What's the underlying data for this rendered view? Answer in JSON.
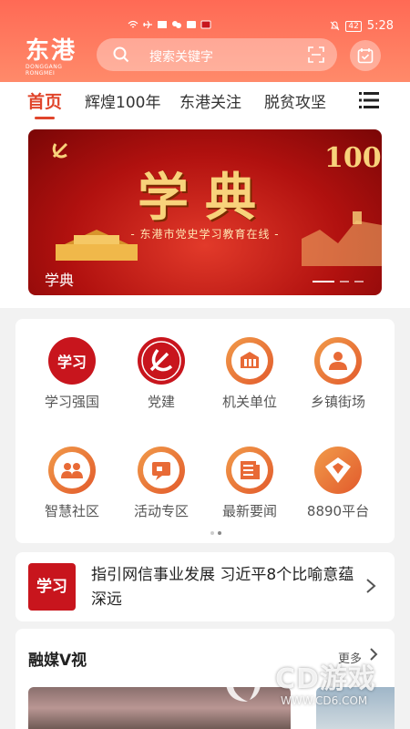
{
  "status_bar": {
    "time": "5:28",
    "battery": "42"
  },
  "header": {
    "logo_text": "东港",
    "logo_subtitle": "DONGGANG RONGMEI",
    "search_placeholder": "搜索关键字"
  },
  "tabs": [
    {
      "label": "首页",
      "active": true
    },
    {
      "label": "辉煌100年",
      "active": false
    },
    {
      "label": "东港关注",
      "active": false
    },
    {
      "label": "脱贫攻坚",
      "active": false
    }
  ],
  "banner": {
    "title": "学典",
    "subtitle": "- 东港市党史学习教育在线 -",
    "badge_number": "100",
    "caption": "学典"
  },
  "grid": [
    {
      "label": "学习强国",
      "icon": "xuexi-qiangguo-icon"
    },
    {
      "label": "党建",
      "icon": "party-emblem-icon"
    },
    {
      "label": "机关单位",
      "icon": "building-icon"
    },
    {
      "label": "乡镇街场",
      "icon": "town-people-icon"
    },
    {
      "label": "智慧社区",
      "icon": "community-icon"
    },
    {
      "label": "活动专区",
      "icon": "activity-icon"
    },
    {
      "label": "最新要闻",
      "icon": "newspaper-icon"
    },
    {
      "label": "8890平台",
      "icon": "platform-8890-icon"
    }
  ],
  "news": {
    "thumb_text": "学习",
    "text": "指引网信事业发展 习近平8个比喻意蕴深远"
  },
  "media": {
    "title": "融媒V视",
    "more_label": "更多"
  },
  "watermark": {
    "main": "CD游戏",
    "sub": "WWW.CD6.COM"
  },
  "colors": {
    "accent": "#e0452b",
    "header": "#ff6a55",
    "party_red": "#c8151d",
    "icon_orange": "#e86a36"
  }
}
